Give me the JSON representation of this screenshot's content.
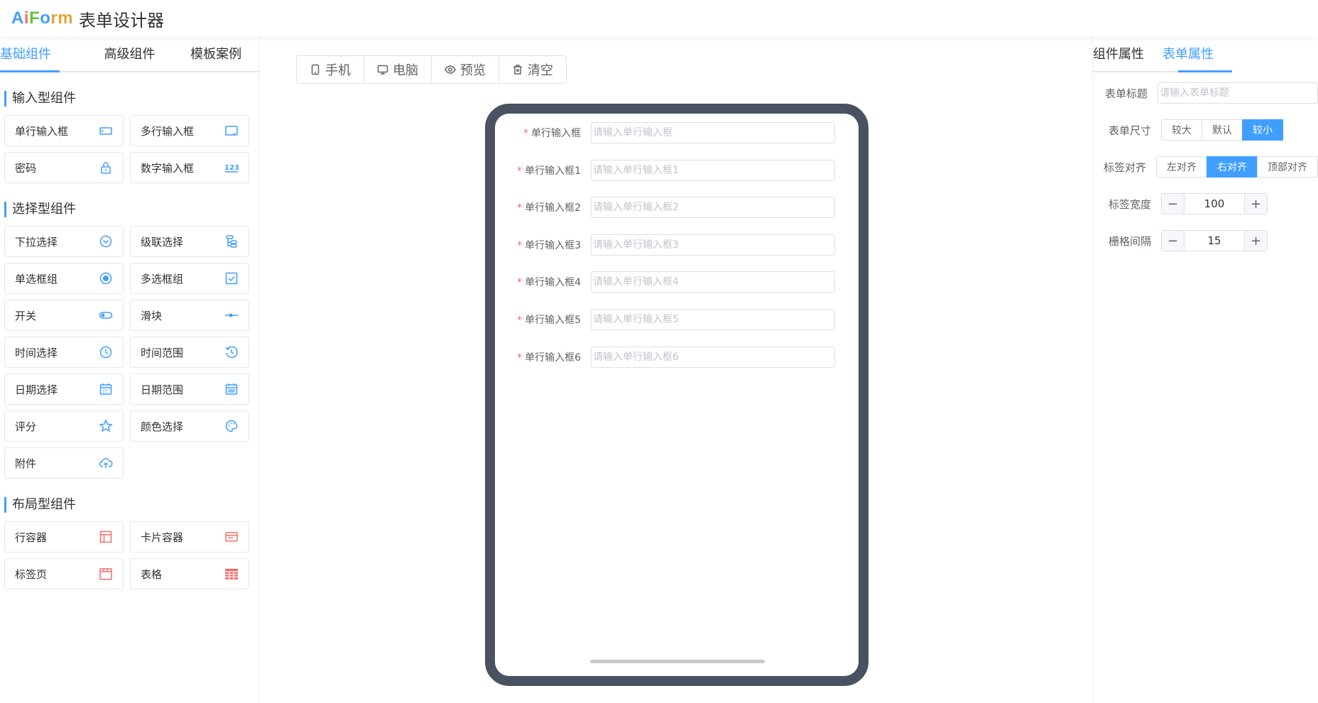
{
  "header": {
    "logo": [
      "A",
      "i",
      "F",
      "o",
      "rm"
    ],
    "title": "表单设计器"
  },
  "left": {
    "tabs": [
      "基础组件",
      "高级组件",
      "模板案例"
    ],
    "groups": [
      {
        "title": "输入型组件",
        "items": [
          "单行输入框",
          "多行输入框",
          "密码",
          "数字输入框"
        ]
      },
      {
        "title": "选择型组件",
        "items": [
          "下拉选择",
          "级联选择",
          "单选框组",
          "多选框组",
          "开关",
          "滑块",
          "时间选择",
          "时间范围",
          "日期选择",
          "日期范围",
          "评分",
          "颜色选择",
          "附件"
        ]
      },
      {
        "title": "布局型组件",
        "items": [
          "行容器",
          "卡片容器",
          "标签页",
          "表格"
        ]
      }
    ],
    "icons": {
      "input": [
        "input-box-icon",
        "textarea-icon",
        "lock-icon",
        "number-123-icon"
      ],
      "select": [
        "select-dropdown-icon",
        "cascader-icon",
        "radio-icon",
        "checkbox-icon",
        "switch-icon",
        "slider-icon",
        "clock-icon",
        "time-range-icon",
        "calendar-icon",
        "date-range-icon",
        "star-icon",
        "palette-icon",
        "upload-cloud-icon"
      ],
      "layout": [
        "row-layout-icon",
        "card-icon",
        "tabs-icon",
        "table-grid-icon"
      ]
    }
  },
  "toolbar": {
    "phone": "手机",
    "pc": "电脑",
    "preview": "预览",
    "clear": "清空"
  },
  "form": {
    "fields": [
      {
        "label": "单行输入框",
        "placeholder": "请输入单行输入框"
      },
      {
        "label": "单行输入框1",
        "placeholder": "请输入单行输入框1"
      },
      {
        "label": "单行输入框2",
        "placeholder": "请输入单行输入框2"
      },
      {
        "label": "单行输入框3",
        "placeholder": "请输入单行输入框3"
      },
      {
        "label": "单行输入框4",
        "placeholder": "请输入单行输入框4"
      },
      {
        "label": "单行输入框5",
        "placeholder": "请输入单行输入框5"
      },
      {
        "label": "单行输入框6",
        "placeholder": "请输入单行输入框6"
      }
    ],
    "required_mark": "*"
  },
  "right": {
    "tabs": [
      "组件属性",
      "表单属性"
    ],
    "form_title": {
      "label": "表单标题",
      "placeholder": "请输入表单标题"
    },
    "form_size": {
      "label": "表单尺寸",
      "options": [
        "较大",
        "默认",
        "较小"
      ],
      "selected": "较小"
    },
    "label_align": {
      "label": "标签对齐",
      "options": [
        "左对齐",
        "右对齐",
        "顶部对齐"
      ],
      "selected": "右对齐"
    },
    "label_width": {
      "label": "标签宽度",
      "value": "100",
      "minus": "−",
      "plus": "+"
    },
    "grid_gutter": {
      "label": "栅格间隔",
      "value": "15",
      "minus": "−",
      "plus": "+"
    }
  },
  "colors": {
    "accent": "#409eff",
    "danger": "#f56c6c",
    "device_frame": "#4a5160"
  }
}
